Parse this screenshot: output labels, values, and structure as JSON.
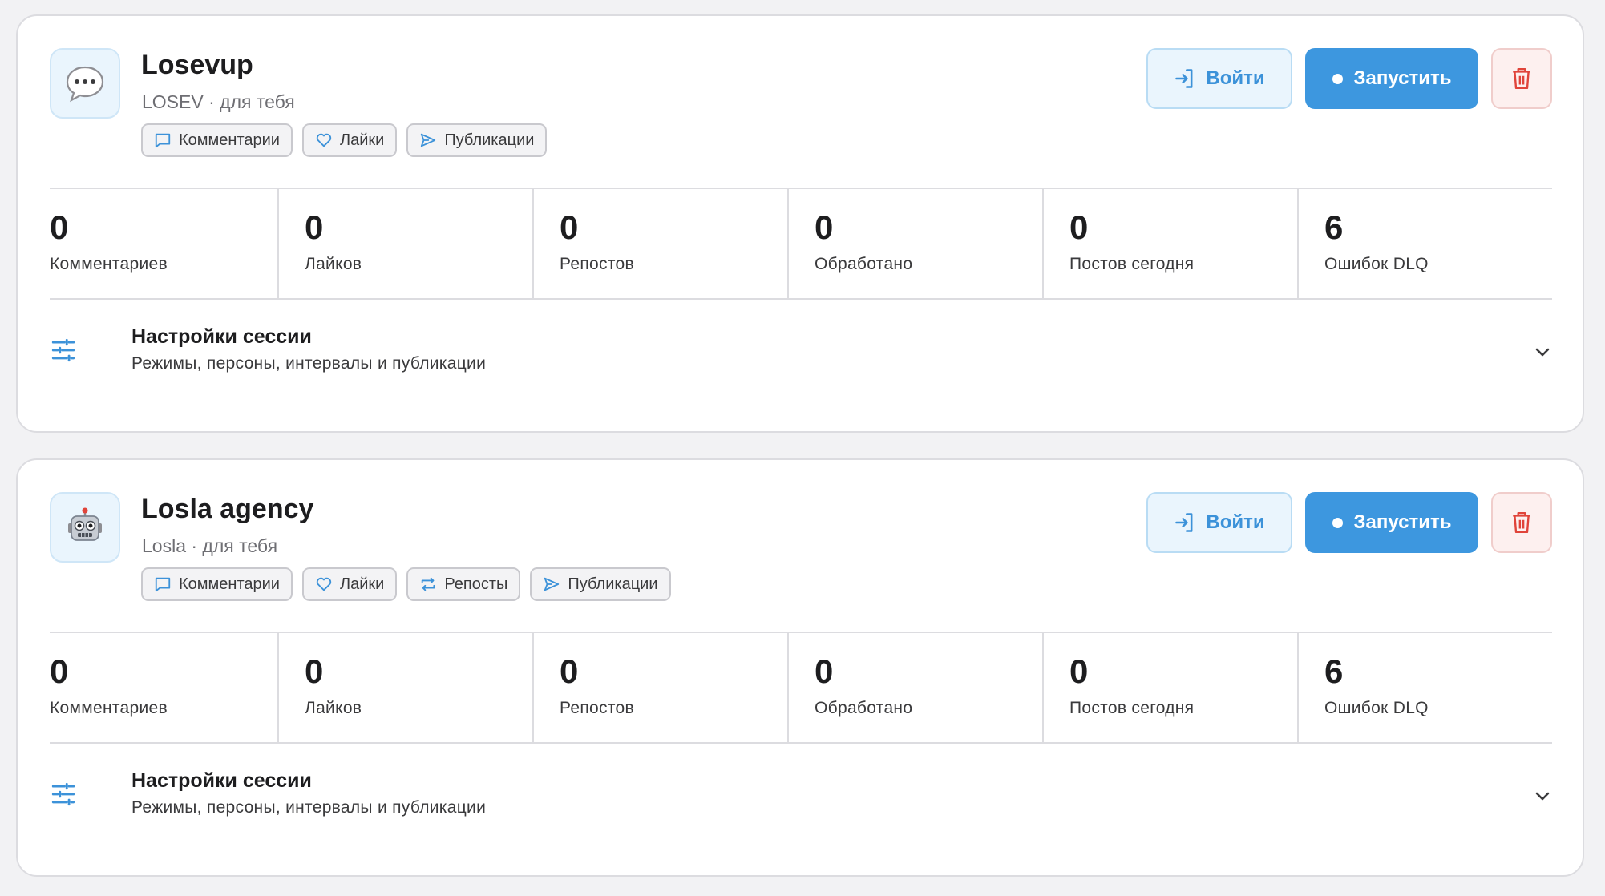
{
  "sessions": [
    {
      "avatar_icon": "speech-bubble-emoji",
      "title": "Losevup",
      "subtitle": "LOSEV · для тебя",
      "tags": [
        {
          "icon": "comment-icon",
          "label": "Комментарии"
        },
        {
          "icon": "heart-icon",
          "label": "Лайки"
        },
        {
          "icon": "send-icon",
          "label": "Публикации"
        }
      ],
      "buttons": {
        "login": "Войти",
        "start": "Запустить",
        "delete_icon": "trash-icon"
      },
      "stats": [
        {
          "value": "0",
          "label": "Комментариев"
        },
        {
          "value": "0",
          "label": "Лайков"
        },
        {
          "value": "0",
          "label": "Репостов"
        },
        {
          "value": "0",
          "label": "Обработано"
        },
        {
          "value": "0",
          "label": "Постов сегодня"
        },
        {
          "value": "6",
          "label": "Ошибок DLQ"
        }
      ],
      "settings": {
        "title": "Настройки сессии",
        "subtitle": "Режимы, персоны, интервалы и публикации"
      }
    },
    {
      "avatar_icon": "robot-emoji",
      "title": "Losla agency",
      "subtitle": "Losla · для тебя",
      "tags": [
        {
          "icon": "comment-icon",
          "label": "Комментарии"
        },
        {
          "icon": "heart-icon",
          "label": "Лайки"
        },
        {
          "icon": "repost-icon",
          "label": "Репосты"
        },
        {
          "icon": "send-icon",
          "label": "Публикации"
        }
      ],
      "buttons": {
        "login": "Войти",
        "start": "Запустить",
        "delete_icon": "trash-icon"
      },
      "stats": [
        {
          "value": "0",
          "label": "Комментариев"
        },
        {
          "value": "0",
          "label": "Лайков"
        },
        {
          "value": "0",
          "label": "Репостов"
        },
        {
          "value": "0",
          "label": "Обработано"
        },
        {
          "value": "0",
          "label": "Постов сегодня"
        },
        {
          "value": "6",
          "label": "Ошибок DLQ"
        }
      ],
      "settings": {
        "title": "Настройки сессии",
        "subtitle": "Режимы, персоны, интервалы и публикации"
      }
    }
  ],
  "colors": {
    "accent": "#3d97df",
    "danger": "#e0443a",
    "background": "#f2f2f4",
    "card": "#ffffff"
  }
}
